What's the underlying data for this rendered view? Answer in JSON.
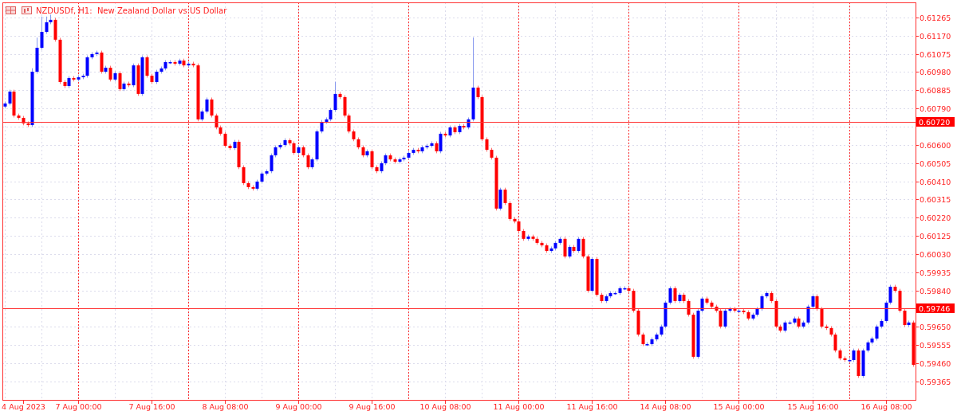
{
  "chart_data": {
    "type": "candlestick",
    "title": "NZDUSDf, H1:  New Zealand Dollar vs US Dollar",
    "grid": true,
    "categories": [
      null,
      null,
      null,
      null,
      "4 Aug 2023",
      null,
      null,
      null,
      null,
      null,
      null,
      null,
      null,
      null,
      null,
      null,
      "7 Aug 00:00",
      null,
      null,
      null,
      null,
      null,
      null,
      null,
      null,
      null,
      null,
      null,
      null,
      null,
      null,
      null,
      "7 Aug 16:00",
      null,
      null,
      null,
      null,
      null,
      null,
      null,
      null,
      null,
      null,
      null,
      null,
      null,
      null,
      null,
      "8 Aug 08:00",
      null,
      null,
      null,
      null,
      null,
      null,
      null,
      null,
      null,
      null,
      null,
      null,
      null,
      null,
      null,
      "9 Aug 00:00",
      null,
      null,
      null,
      null,
      null,
      null,
      null,
      null,
      null,
      null,
      null,
      null,
      null,
      null,
      null,
      "9 Aug 16:00",
      null,
      null,
      null,
      null,
      null,
      null,
      null,
      null,
      null,
      null,
      null,
      null,
      null,
      null,
      null,
      "10 Aug 08:00",
      null,
      null,
      null,
      null,
      null,
      null,
      null,
      null,
      null,
      null,
      null,
      null,
      null,
      null,
      null,
      "11 Aug 00:00",
      null,
      null,
      null,
      null,
      null,
      null,
      null,
      null,
      null,
      null,
      null,
      null,
      null,
      null,
      null,
      "11 Aug 16:00",
      null,
      null,
      null,
      null,
      null,
      null,
      null,
      null,
      null,
      null,
      null,
      null,
      null,
      null,
      null,
      "14 Aug 08:00",
      null,
      null,
      null,
      null,
      null,
      null,
      null,
      null,
      null,
      null,
      null,
      null,
      null,
      null,
      null,
      "15 Aug 00:00",
      null,
      null,
      null,
      null,
      null,
      null,
      null,
      null,
      null,
      null,
      null,
      null,
      null,
      null,
      null,
      "15 Aug 16:00",
      null,
      null,
      null,
      null,
      null,
      null,
      null,
      null,
      null,
      null,
      null,
      null,
      null,
      null,
      null,
      "16 Aug 08:00",
      null,
      null,
      null,
      null,
      null,
      null
    ],
    "ohlc": [
      [
        0.608,
        0.60826,
        0.6079,
        0.60816
      ],
      [
        0.60816,
        0.60888,
        0.60806,
        0.60878
      ],
      [
        0.60878,
        0.60888,
        0.60743,
        0.60753
      ],
      [
        0.60753,
        0.60763,
        0.60731,
        0.60741
      ],
      [
        0.60741,
        0.60751,
        0.60702,
        0.60712
      ],
      [
        0.60712,
        0.60722,
        0.60693,
        0.60703
      ],
      [
        0.60703,
        0.61,
        0.60693,
        0.60982
      ],
      [
        0.60982,
        0.6116,
        0.60972,
        0.61107
      ],
      [
        0.61107,
        0.6127,
        0.61097,
        0.6119
      ],
      [
        0.6119,
        0.6127,
        0.6118,
        0.6124
      ],
      [
        0.6124,
        0.6128,
        0.6123,
        0.61253
      ],
      [
        0.61253,
        0.61263,
        0.61139,
        0.61149
      ],
      [
        0.61149,
        0.61159,
        0.60918,
        0.60928
      ],
      [
        0.60928,
        0.60938,
        0.60897,
        0.60907
      ],
      [
        0.60907,
        0.60959,
        0.60897,
        0.60949
      ],
      [
        0.60949,
        0.60959,
        0.60931,
        0.60941
      ],
      [
        0.60941,
        0.60963,
        0.60931,
        0.60953
      ],
      [
        0.60953,
        0.60971,
        0.60943,
        0.60961
      ],
      [
        0.60961,
        0.61067,
        0.60951,
        0.61057
      ],
      [
        0.61057,
        0.61084,
        0.61047,
        0.61074
      ],
      [
        0.61074,
        0.61092,
        0.61064,
        0.61082
      ],
      [
        0.61082,
        0.61092,
        0.60972,
        0.60982
      ],
      [
        0.60982,
        0.61013,
        0.60972,
        0.61003
      ],
      [
        0.61003,
        0.61013,
        0.60931,
        0.60941
      ],
      [
        0.60941,
        0.60984,
        0.60931,
        0.60974
      ],
      [
        0.60974,
        0.60984,
        0.60881,
        0.60891
      ],
      [
        0.60891,
        0.6093,
        0.60881,
        0.6092
      ],
      [
        0.6092,
        0.6093,
        0.60901,
        0.60911
      ],
      [
        0.60911,
        0.61025,
        0.60901,
        0.61015
      ],
      [
        0.61015,
        0.61025,
        0.60856,
        0.60866
      ],
      [
        0.60866,
        0.61067,
        0.60856,
        0.61057
      ],
      [
        0.61057,
        0.61067,
        0.60951,
        0.60961
      ],
      [
        0.60961,
        0.60971,
        0.60918,
        0.60928
      ],
      [
        0.60928,
        0.60992,
        0.60918,
        0.60982
      ],
      [
        0.60982,
        0.61009,
        0.60972,
        0.60999
      ],
      [
        0.60999,
        0.61042,
        0.60989,
        0.61032
      ],
      [
        0.61032,
        0.61042,
        0.61022,
        0.61032
      ],
      [
        0.61032,
        0.61042,
        0.61014,
        0.61024
      ],
      [
        0.61024,
        0.6105,
        0.61014,
        0.6104
      ],
      [
        0.6104,
        0.6105,
        0.61005,
        0.61015
      ],
      [
        0.61015,
        0.61034,
        0.61005,
        0.61024
      ],
      [
        0.61024,
        0.61034,
        0.61005,
        0.61015
      ],
      [
        0.61015,
        0.61025,
        0.60723,
        0.60733
      ],
      [
        0.60733,
        0.60784,
        0.60723,
        0.60774
      ],
      [
        0.60774,
        0.60847,
        0.60764,
        0.60837
      ],
      [
        0.60837,
        0.60847,
        0.60743,
        0.60753
      ],
      [
        0.60753,
        0.60763,
        0.60681,
        0.60691
      ],
      [
        0.60691,
        0.60701,
        0.60648,
        0.60658
      ],
      [
        0.60658,
        0.60668,
        0.60585,
        0.60595
      ],
      [
        0.60595,
        0.60605,
        0.60573,
        0.60583
      ],
      [
        0.60583,
        0.60626,
        0.60573,
        0.60616
      ],
      [
        0.60616,
        0.60626,
        0.60473,
        0.60483
      ],
      [
        0.60483,
        0.60493,
        0.6039,
        0.604
      ],
      [
        0.604,
        0.6041,
        0.60369,
        0.60379
      ],
      [
        0.60379,
        0.60389,
        0.60361,
        0.60371
      ],
      [
        0.60371,
        0.60418,
        0.60361,
        0.60408
      ],
      [
        0.60408,
        0.6046,
        0.60398,
        0.6045
      ],
      [
        0.6045,
        0.60472,
        0.6044,
        0.60462
      ],
      [
        0.60462,
        0.60555,
        0.60452,
        0.60545
      ],
      [
        0.60545,
        0.60597,
        0.60535,
        0.60587
      ],
      [
        0.60587,
        0.60609,
        0.60577,
        0.60599
      ],
      [
        0.60599,
        0.60634,
        0.60589,
        0.60624
      ],
      [
        0.60624,
        0.60634,
        0.60598,
        0.60608
      ],
      [
        0.60608,
        0.60618,
        0.60548,
        0.60558
      ],
      [
        0.60558,
        0.60597,
        0.60548,
        0.60587
      ],
      [
        0.60587,
        0.60597,
        0.60535,
        0.60545
      ],
      [
        0.60545,
        0.60555,
        0.60473,
        0.60483
      ],
      [
        0.60483,
        0.60534,
        0.60473,
        0.60524
      ],
      [
        0.60524,
        0.6068,
        0.60514,
        0.6067
      ],
      [
        0.6067,
        0.6073,
        0.6066,
        0.6072
      ],
      [
        0.6072,
        0.60743,
        0.6071,
        0.60733
      ],
      [
        0.60733,
        0.60792,
        0.60723,
        0.60782
      ],
      [
        0.60782,
        0.6093,
        0.60772,
        0.60866
      ],
      [
        0.60866,
        0.60876,
        0.60839,
        0.60849
      ],
      [
        0.60849,
        0.60859,
        0.60743,
        0.60753
      ],
      [
        0.60753,
        0.60763,
        0.6066,
        0.6067
      ],
      [
        0.6067,
        0.6068,
        0.60619,
        0.60629
      ],
      [
        0.60629,
        0.60639,
        0.60577,
        0.60587
      ],
      [
        0.60587,
        0.60597,
        0.60535,
        0.60545
      ],
      [
        0.60545,
        0.60576,
        0.60535,
        0.60566
      ],
      [
        0.60566,
        0.60576,
        0.60473,
        0.60483
      ],
      [
        0.60483,
        0.60493,
        0.60452,
        0.60462
      ],
      [
        0.60462,
        0.60514,
        0.60452,
        0.60504
      ],
      [
        0.60504,
        0.60555,
        0.60494,
        0.60545
      ],
      [
        0.60545,
        0.60555,
        0.60514,
        0.60524
      ],
      [
        0.60524,
        0.60534,
        0.60502,
        0.60512
      ],
      [
        0.60512,
        0.60534,
        0.60502,
        0.60524
      ],
      [
        0.60524,
        0.60543,
        0.60514,
        0.60533
      ],
      [
        0.60533,
        0.60568,
        0.60523,
        0.60558
      ],
      [
        0.60558,
        0.60584,
        0.60548,
        0.60574
      ],
      [
        0.60574,
        0.60584,
        0.60556,
        0.60566
      ],
      [
        0.60566,
        0.60597,
        0.60556,
        0.60587
      ],
      [
        0.60587,
        0.60605,
        0.60577,
        0.60595
      ],
      [
        0.60595,
        0.60618,
        0.60585,
        0.60608
      ],
      [
        0.60608,
        0.60618,
        0.60556,
        0.60566
      ],
      [
        0.60566,
        0.60668,
        0.60556,
        0.60658
      ],
      [
        0.60658,
        0.60668,
        0.60639,
        0.60649
      ],
      [
        0.60649,
        0.60701,
        0.60639,
        0.60691
      ],
      [
        0.60691,
        0.60701,
        0.60656,
        0.60666
      ],
      [
        0.60666,
        0.60709,
        0.60656,
        0.60699
      ],
      [
        0.60699,
        0.60709,
        0.60681,
        0.60691
      ],
      [
        0.60691,
        0.60743,
        0.60681,
        0.60733
      ],
      [
        0.60733,
        0.61161,
        0.60723,
        0.60899
      ],
      [
        0.60899,
        0.60909,
        0.60839,
        0.60849
      ],
      [
        0.60849,
        0.60859,
        0.60619,
        0.60629
      ],
      [
        0.60629,
        0.60639,
        0.60564,
        0.60574
      ],
      [
        0.60574,
        0.60584,
        0.60523,
        0.60533
      ],
      [
        0.60533,
        0.60543,
        0.60257,
        0.60267
      ],
      [
        0.60267,
        0.60376,
        0.60257,
        0.60366
      ],
      [
        0.60366,
        0.60376,
        0.60286,
        0.60296
      ],
      [
        0.60296,
        0.60306,
        0.60203,
        0.60213
      ],
      [
        0.60213,
        0.60223,
        0.6019,
        0.602
      ],
      [
        0.602,
        0.6021,
        0.6014,
        0.6015
      ],
      [
        0.6015,
        0.6016,
        0.60099,
        0.60109
      ],
      [
        0.60109,
        0.60131,
        0.60099,
        0.60121
      ],
      [
        0.60121,
        0.60131,
        0.60099,
        0.60109
      ],
      [
        0.60109,
        0.60119,
        0.60078,
        0.60088
      ],
      [
        0.60088,
        0.60098,
        0.60065,
        0.60075
      ],
      [
        0.60075,
        0.60085,
        0.60036,
        0.60046
      ],
      [
        0.60046,
        0.60069,
        0.60036,
        0.60059
      ],
      [
        0.60059,
        0.60098,
        0.60049,
        0.60088
      ],
      [
        0.60088,
        0.60119,
        0.60078,
        0.60109
      ],
      [
        0.60109,
        0.60119,
        0.60007,
        0.60017
      ],
      [
        0.60017,
        0.60077,
        0.60007,
        0.60067
      ],
      [
        0.60067,
        0.60077,
        0.60036,
        0.60046
      ],
      [
        0.60046,
        0.60119,
        0.60036,
        0.60109
      ],
      [
        0.60109,
        0.60119,
        0.60007,
        0.60017
      ],
      [
        0.60017,
        0.60027,
        0.59828,
        0.59838
      ],
      [
        0.59838,
        0.60014,
        0.59828,
        0.60004
      ],
      [
        0.60004,
        0.60014,
        0.59807,
        0.59817
      ],
      [
        0.59817,
        0.59827,
        0.59774,
        0.59784
      ],
      [
        0.59784,
        0.59819,
        0.59774,
        0.59809
      ],
      [
        0.59809,
        0.59836,
        0.59799,
        0.59826
      ],
      [
        0.59826,
        0.59836,
        0.59816,
        0.59826
      ],
      [
        0.59826,
        0.59861,
        0.59816,
        0.59851
      ],
      [
        0.59851,
        0.59861,
        0.59841,
        0.59851
      ],
      [
        0.59851,
        0.59861,
        0.59828,
        0.59838
      ],
      [
        0.59838,
        0.59848,
        0.59724,
        0.59734
      ],
      [
        0.59734,
        0.59744,
        0.59599,
        0.59609
      ],
      [
        0.59609,
        0.59619,
        0.59549,
        0.59559
      ],
      [
        0.59559,
        0.59569,
        0.59549,
        0.59559
      ],
      [
        0.59559,
        0.59594,
        0.59549,
        0.59584
      ],
      [
        0.59584,
        0.59619,
        0.59574,
        0.59609
      ],
      [
        0.59609,
        0.59661,
        0.59599,
        0.59651
      ],
      [
        0.59651,
        0.59786,
        0.59641,
        0.59776
      ],
      [
        0.59776,
        0.59861,
        0.59766,
        0.59851
      ],
      [
        0.59851,
        0.59861,
        0.59774,
        0.59784
      ],
      [
        0.59784,
        0.59827,
        0.59774,
        0.59817
      ],
      [
        0.59817,
        0.59827,
        0.59774,
        0.59784
      ],
      [
        0.59784,
        0.59794,
        0.59703,
        0.59713
      ],
      [
        0.59713,
        0.59723,
        0.59483,
        0.59493
      ],
      [
        0.59493,
        0.59744,
        0.59483,
        0.59734
      ],
      [
        0.59734,
        0.59807,
        0.59724,
        0.59797
      ],
      [
        0.59797,
        0.59807,
        0.59766,
        0.59776
      ],
      [
        0.59776,
        0.59786,
        0.59745,
        0.59755
      ],
      [
        0.59755,
        0.59765,
        0.59724,
        0.59734
      ],
      [
        0.59734,
        0.59744,
        0.59641,
        0.59651
      ],
      [
        0.59651,
        0.59744,
        0.59641,
        0.59734
      ],
      [
        0.59734,
        0.59753,
        0.59724,
        0.59743
      ],
      [
        0.59743,
        0.59753,
        0.59724,
        0.59734
      ],
      [
        0.59734,
        0.59744,
        0.59724,
        0.59734
      ],
      [
        0.59734,
        0.59744,
        0.59716,
        0.59726
      ],
      [
        0.59726,
        0.59736,
        0.59683,
        0.59693
      ],
      [
        0.59693,
        0.59723,
        0.59683,
        0.59713
      ],
      [
        0.59713,
        0.59753,
        0.59703,
        0.59743
      ],
      [
        0.59743,
        0.59819,
        0.59733,
        0.59809
      ],
      [
        0.59809,
        0.59836,
        0.59799,
        0.59826
      ],
      [
        0.59826,
        0.59836,
        0.59774,
        0.59784
      ],
      [
        0.59784,
        0.59794,
        0.59641,
        0.59651
      ],
      [
        0.59651,
        0.59661,
        0.5962,
        0.5963
      ],
      [
        0.5963,
        0.59682,
        0.5962,
        0.59672
      ],
      [
        0.59672,
        0.59682,
        0.59662,
        0.59672
      ],
      [
        0.59672,
        0.59703,
        0.59662,
        0.59693
      ],
      [
        0.59693,
        0.59703,
        0.59641,
        0.59651
      ],
      [
        0.59651,
        0.59682,
        0.59641,
        0.59672
      ],
      [
        0.59672,
        0.59765,
        0.59662,
        0.59755
      ],
      [
        0.59755,
        0.59819,
        0.59745,
        0.59809
      ],
      [
        0.59809,
        0.59819,
        0.59733,
        0.59743
      ],
      [
        0.59743,
        0.59753,
        0.59641,
        0.59651
      ],
      [
        0.59651,
        0.59661,
        0.59633,
        0.59643
      ],
      [
        0.59643,
        0.59653,
        0.59599,
        0.59609
      ],
      [
        0.59609,
        0.59619,
        0.59516,
        0.59526
      ],
      [
        0.59526,
        0.59536,
        0.59475,
        0.59485
      ],
      [
        0.59485,
        0.59495,
        0.59466,
        0.59476
      ],
      [
        0.59476,
        0.59486,
        0.59466,
        0.59476
      ],
      [
        0.59476,
        0.59536,
        0.59466,
        0.59526
      ],
      [
        0.59526,
        0.59536,
        0.59383,
        0.59393
      ],
      [
        0.59393,
        0.59536,
        0.59383,
        0.59526
      ],
      [
        0.59526,
        0.59578,
        0.59516,
        0.59568
      ],
      [
        0.59568,
        0.59598,
        0.59558,
        0.59588
      ],
      [
        0.59588,
        0.59661,
        0.59578,
        0.59651
      ],
      [
        0.59651,
        0.5969,
        0.59641,
        0.5968
      ],
      [
        0.5968,
        0.59786,
        0.5967,
        0.59776
      ],
      [
        0.59776,
        0.59869,
        0.59766,
        0.59859
      ],
      [
        0.59859,
        0.59869,
        0.59828,
        0.59838
      ],
      [
        0.59838,
        0.59848,
        0.59724,
        0.59734
      ],
      [
        0.59734,
        0.59744,
        0.59649,
        0.59659
      ],
      [
        0.59659,
        0.59682,
        0.59649,
        0.59672
      ],
      [
        0.59672,
        0.59682,
        0.59441,
        0.59451
      ]
    ],
    "ylim": [
      0.59268,
      0.61344
    ],
    "yticks": [
      {
        "value": 0.61265,
        "label": "0.61265"
      },
      {
        "value": 0.6117,
        "label": "0.61170"
      },
      {
        "value": 0.61075,
        "label": "0.61075"
      },
      {
        "value": 0.6098,
        "label": "0.60980"
      },
      {
        "value": 0.60885,
        "label": "0.60885"
      },
      {
        "value": 0.6079,
        "label": "0.60790"
      },
      {
        "value": 0.606,
        "label": "0.60600"
      },
      {
        "value": 0.60505,
        "label": "0.60505"
      },
      {
        "value": 0.6041,
        "label": "0.60410"
      },
      {
        "value": 0.60315,
        "label": "0.60315"
      },
      {
        "value": 0.6022,
        "label": "0.60220"
      },
      {
        "value": 0.60125,
        "label": "0.60125"
      },
      {
        "value": 0.6003,
        "label": "0.60030"
      },
      {
        "value": 0.59935,
        "label": "0.59935"
      },
      {
        "value": 0.5984,
        "label": "0.59840"
      },
      {
        "value": 0.5965,
        "label": "0.59650"
      },
      {
        "value": 0.59555,
        "label": "0.59555"
      },
      {
        "value": 0.5946,
        "label": "0.59460"
      },
      {
        "value": 0.59365,
        "label": "0.59365"
      }
    ],
    "ref_lines": [
      {
        "axis": "y",
        "value": 0.6072,
        "label": "0.60720"
      },
      {
        "axis": "y",
        "value": 0.59746,
        "label": "0.59746"
      }
    ]
  }
}
